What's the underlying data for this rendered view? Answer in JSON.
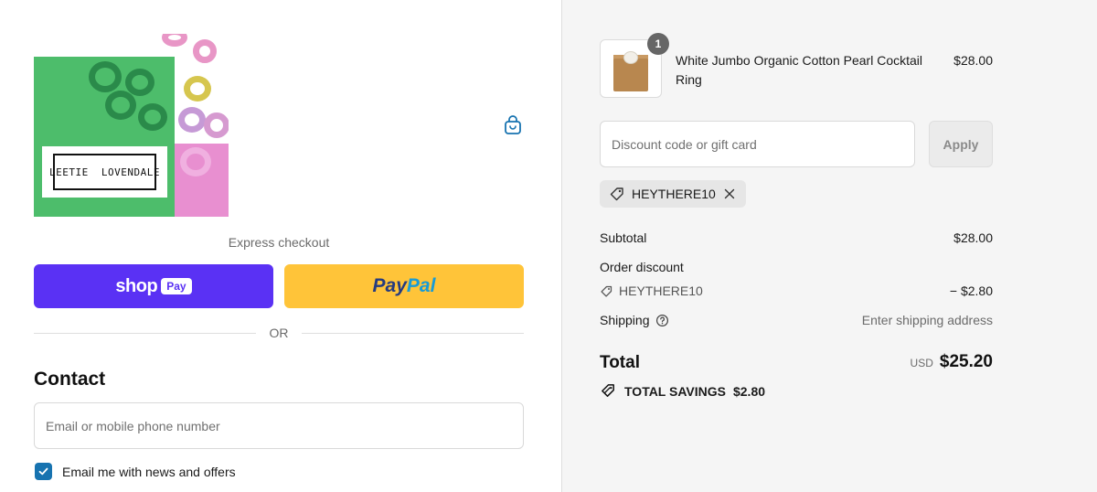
{
  "logo": {
    "text": "LEETIE  LOVENDALE"
  },
  "cart": {
    "icon": "shopping-bag-icon"
  },
  "express_checkout": {
    "label": "Express checkout",
    "shop_pay": {
      "word": "shop",
      "badge": "Pay"
    },
    "paypal": {
      "part1": "Pay",
      "part2": "Pal"
    },
    "divider": "OR"
  },
  "contact": {
    "title": "Contact",
    "email_placeholder": "Email or mobile phone number",
    "email_value": "",
    "newsletter_label": "Email me with news and offers",
    "newsletter_checked": true
  },
  "order": {
    "item": {
      "name": "White Jumbo Organic Cotton Pearl Cocktail Ring",
      "price": "$28.00",
      "quantity": "1"
    },
    "discount": {
      "placeholder": "Discount code or gift card",
      "value": "",
      "apply_label": "Apply",
      "applied_code": "HEYTHERE10"
    },
    "subtotal": {
      "label": "Subtotal",
      "value": "$28.00"
    },
    "order_discount": {
      "label": "Order discount",
      "code": "HEYTHERE10",
      "value": "− $2.80"
    },
    "shipping": {
      "label": "Shipping",
      "value": "Enter shipping address"
    },
    "total": {
      "label": "Total",
      "currency": "USD",
      "value": "$25.20"
    },
    "savings": {
      "label": "TOTAL SAVINGS",
      "value": "$2.80"
    }
  },
  "colors": {
    "shop_pay": "#5a31f4",
    "paypal": "#ffc439",
    "checkbox": "#1773b0",
    "summary_bg": "#f5f5f5"
  }
}
